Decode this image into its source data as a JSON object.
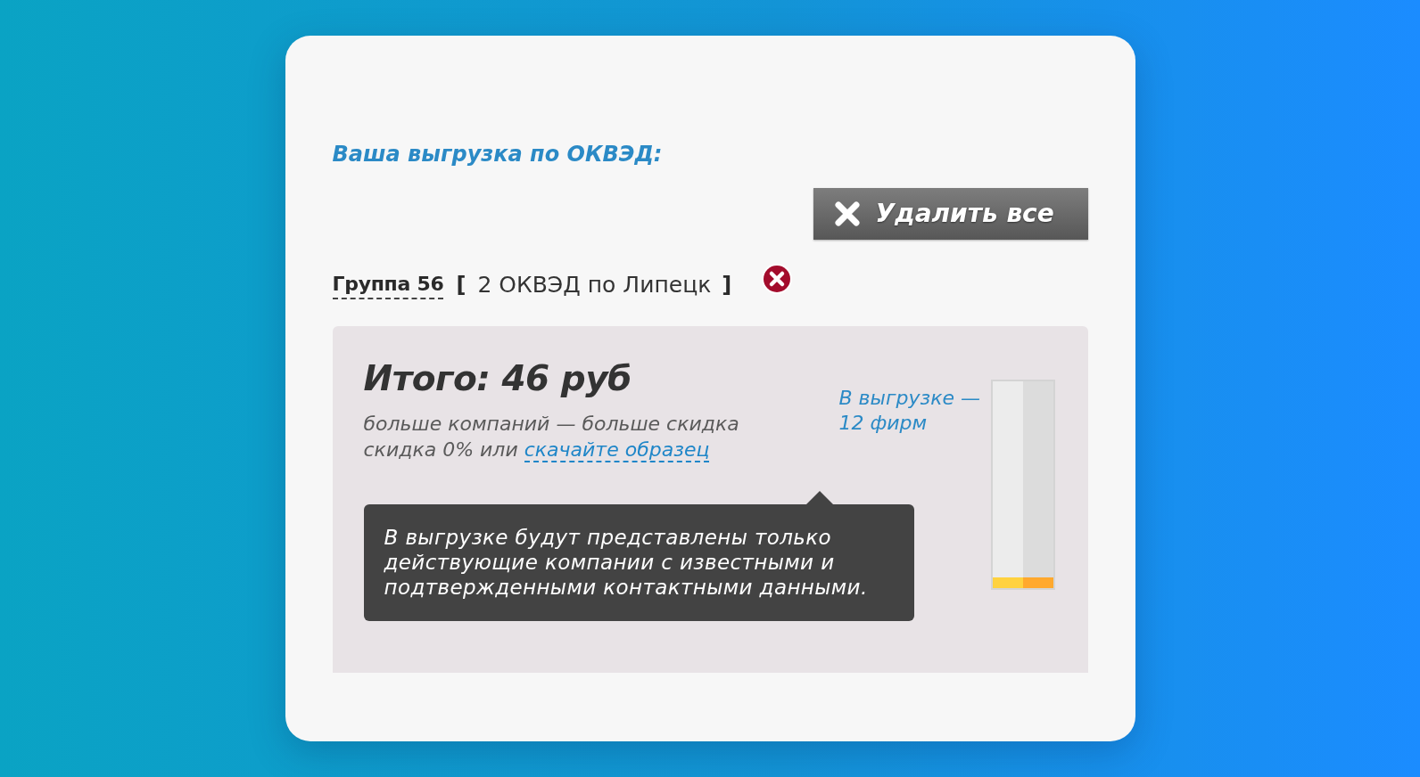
{
  "header": {
    "title": "Ваша выгрузка по ОКВЭД:"
  },
  "delete_all_button": {
    "label": "Удалить все"
  },
  "group": {
    "name": "Группа 56",
    "open_bracket": "[",
    "summary": "2 ОКВЭД по Липецк",
    "close_bracket": "]"
  },
  "summary": {
    "total": "Итого: 46 руб",
    "discount_note": "больше компаний — больше скидка",
    "discount_offer": "скидка 0% или",
    "sample_link": "скачайте образец",
    "tooltip": "В выгрузке будут представлены только действующие компании с известными и подтвержденными контактными данными.",
    "count_label": "В выгрузке — 12 фирм",
    "meter": {
      "level": 0.05
    }
  }
}
